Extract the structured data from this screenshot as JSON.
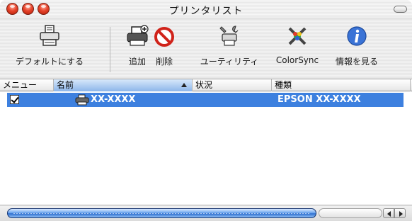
{
  "window": {
    "title": "プリンタリスト",
    "controls": [
      "close-button",
      "minimize-button",
      "zoom-button"
    ]
  },
  "toolbar": {
    "buttons": [
      {
        "label": "デフォルトにする",
        "icon": "default-printer-icon"
      },
      {
        "label": "追加",
        "icon": "add-printer-icon"
      },
      {
        "label": "削除",
        "icon": "delete-icon"
      },
      {
        "label": "ユーティリティ",
        "icon": "utility-icon"
      },
      {
        "label": "ColorSync",
        "icon": "colorsync-icon"
      },
      {
        "label": "情報を見る",
        "icon": "info-icon"
      }
    ]
  },
  "table": {
    "columns": [
      "メニュー",
      "名前",
      "状況",
      "種類"
    ],
    "sorted_column": "名前",
    "rows": [
      {
        "checked": true,
        "name": "XX-XXXX",
        "status": "",
        "type": "EPSON XX-XXXX",
        "selected": true
      }
    ]
  },
  "colors": {
    "selection": "#3d80df",
    "accent": "#2e6fcf"
  }
}
